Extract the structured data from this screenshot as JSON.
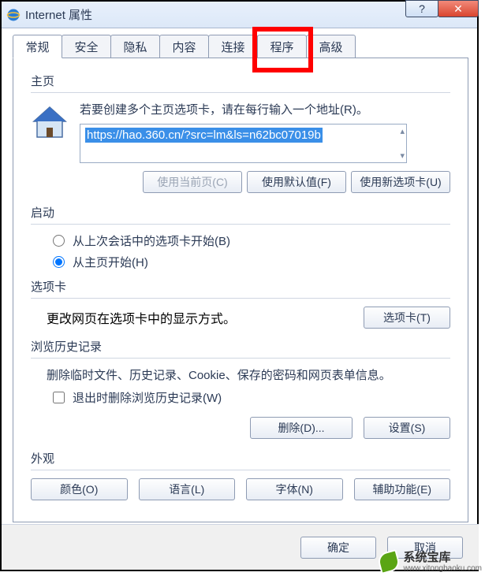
{
  "window": {
    "title": "Internet 属性"
  },
  "tabs": [
    "常规",
    "安全",
    "隐私",
    "内容",
    "连接",
    "程序",
    "高级"
  ],
  "highlight_tab_index": 5,
  "home": {
    "label": "主页",
    "desc": "若要创建多个主页选项卡，请在每行输入一个地址(R)。",
    "url": "https://hao.360.cn/?src=lm&ls=n62bc07019b",
    "btn_current": "使用当前页(C)",
    "btn_default": "使用默认值(F)",
    "btn_newtab": "使用新选项卡(U)"
  },
  "startup": {
    "label": "启动",
    "opt_last": "从上次会话中的选项卡开始(B)",
    "opt_home": "从主页开始(H)"
  },
  "tabsection": {
    "label": "选项卡",
    "desc": "更改网页在选项卡中的显示方式。",
    "btn": "选项卡(T)"
  },
  "history": {
    "label": "浏览历史记录",
    "desc": "删除临时文件、历史记录、Cookie、保存的密码和网页表单信息。",
    "chk": "退出时删除浏览历史记录(W)",
    "btn_del": "删除(D)...",
    "btn_set": "设置(S)"
  },
  "appearance": {
    "label": "外观",
    "btn_color": "颜色(O)",
    "btn_lang": "语言(L)",
    "btn_font": "字体(N)",
    "btn_acc": "辅助功能(E)"
  },
  "footer": {
    "ok": "确定",
    "cancel": "取消"
  },
  "watermark": {
    "name": "系统宝库",
    "url": "www.xitongbaoku.com"
  }
}
